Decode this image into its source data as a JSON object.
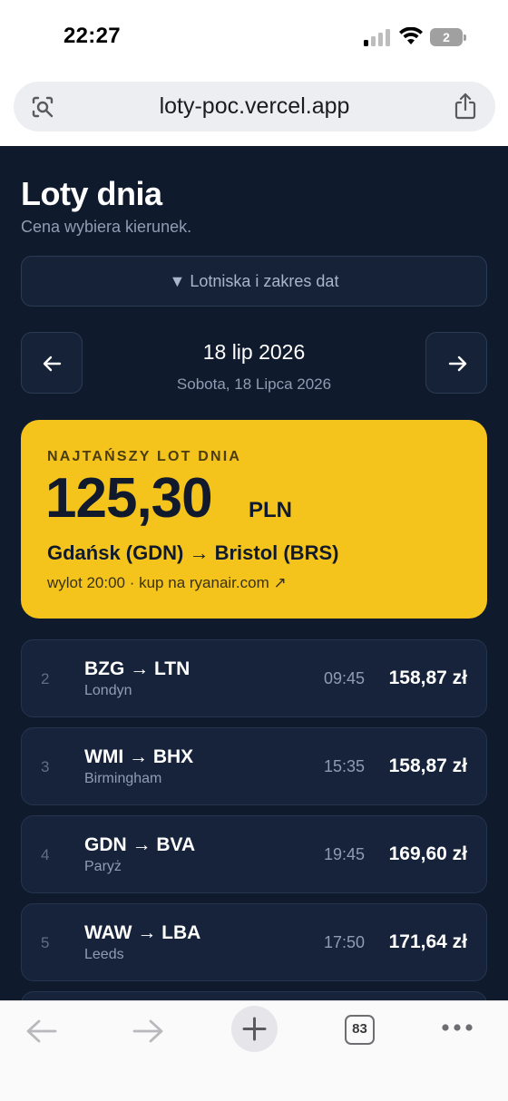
{
  "status_bar": {
    "time": "22:27",
    "battery_level": "2"
  },
  "browser": {
    "url": "loty-poc.vercel.app",
    "tab_count": "83"
  },
  "page": {
    "title": "Loty dnia",
    "subtitle": "Cena wybiera kierunek.",
    "filter_toggle": "▼ Lotniska i zakres dat"
  },
  "date_nav": {
    "date_short": "18 lip 2026",
    "date_long": "Sobota, 18 Lipca 2026"
  },
  "cheapest": {
    "label": "NAJTAŃSZY LOT DNIA",
    "price": "125,30",
    "currency": "PLN",
    "route": "Gdańsk (GDN) → Bristol (BRS)",
    "link": "wylot 20:00 · kup na ryanair.com ↗"
  },
  "flights": [
    {
      "rank": "2",
      "route": "BZG → LTN",
      "city": "Londyn",
      "time": "09:45",
      "price": "158,87 zł"
    },
    {
      "rank": "3",
      "route": "WMI → BHX",
      "city": "Birmingham",
      "time": "15:35",
      "price": "158,87 zł"
    },
    {
      "rank": "4",
      "route": "GDN → BVA",
      "city": "Paryż",
      "time": "19:45",
      "price": "169,60 zł"
    },
    {
      "rank": "5",
      "route": "WAW → LBA",
      "city": "Leeds",
      "time": "17:50",
      "price": "171,64 zł"
    }
  ],
  "colors": {
    "background": "#0f1a2c",
    "card": "#16233a",
    "accent": "#f4c41c",
    "muted_text": "#8f9cb3"
  },
  "icons": {
    "prev": "arrow-left-icon",
    "next": "arrow-right-icon",
    "share": "share-icon",
    "page_tools": "page-tools-icon"
  }
}
